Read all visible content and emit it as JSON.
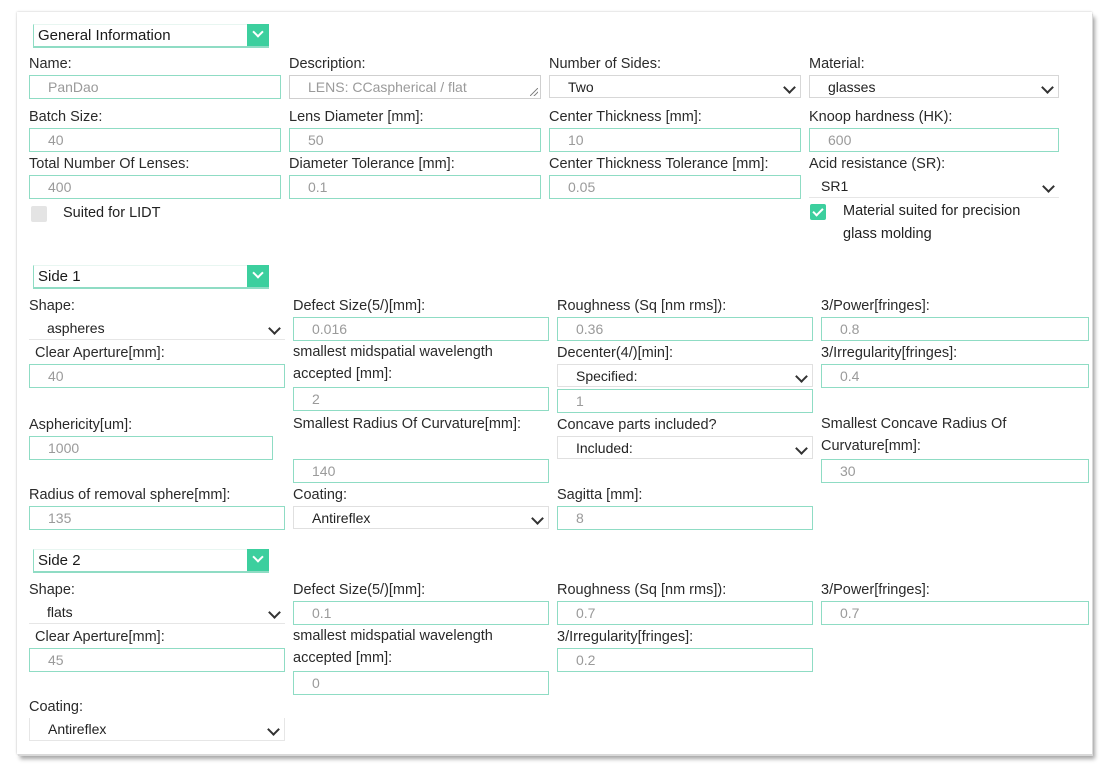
{
  "general": {
    "title": "General Information",
    "name_label": "Name:",
    "name_value": "PanDao",
    "description_label": "Description:",
    "description_value": "LENS:  CCaspherical / flat",
    "sides_label": "Number of Sides:",
    "sides_value": "Two",
    "material_label": "Material:",
    "material_value": "glasses",
    "batch_label": "Batch Size:",
    "batch_value": "40",
    "lens_diameter_label": "Lens Diameter [mm]:",
    "lens_diameter_value": "50",
    "center_thickness_label": "Center Thickness [mm]:",
    "center_thickness_value": "10",
    "knoop_label": "Knoop hardness (HK):",
    "knoop_value": "600",
    "total_label": "Total Number Of Lenses:",
    "total_value": "400",
    "diameter_tol_label": "Diameter Tolerance [mm]:",
    "diameter_tol_value": "0.1",
    "center_tol_label": "Center Thickness Tolerance [mm]:",
    "center_tol_value": "0.05",
    "acid_label": "Acid resistance (SR):",
    "acid_value": "SR1",
    "lidt_label": "Suited for LIDT",
    "lidt_checked": false,
    "molding_label": "Material suited for precision glass molding",
    "molding_checked": true
  },
  "side1": {
    "title": "Side 1",
    "shape_label": "Shape:",
    "shape_value": "aspheres",
    "defect_label": "Defect Size(5/)[mm]:",
    "defect_value": "0.016",
    "roughness_label": "Roughness (Sq [nm rms]):",
    "roughness_value": "0.36",
    "power_label": "3/Power[fringes]:",
    "power_value": "0.8",
    "clear_aperture_label": "Clear Aperture[mm]:",
    "clear_aperture_value": "40",
    "midspatial_label": "smallest midspatial wavelength accepted [mm]:",
    "midspatial_value": "2",
    "decenter_label": "Decenter(4/)[min]:",
    "decenter_select": "Specified:",
    "decenter_value": "1",
    "irregularity_label": "3/Irregularity[fringes]:",
    "irregularity_value": "0.4",
    "asphericity_label": "Asphericity[um]:",
    "asphericity_value": "1000",
    "radius_label": "Smallest Radius Of Curvature[mm]:",
    "radius_value": "140",
    "concave_label": "Concave parts included?",
    "concave_value": "Included:",
    "concave_radius_label": "Smallest Concave Radius Of Curvature[mm]:",
    "concave_radius_value": "30",
    "removal_label": "Radius of removal sphere[mm]:",
    "removal_value": "135",
    "coating_label": "Coating:",
    "coating_value": "Antireflex",
    "sagitta_label": "Sagitta [mm]:",
    "sagitta_value": "8"
  },
  "side2": {
    "title": "Side 2",
    "shape_label": "Shape:",
    "shape_value": "flats",
    "defect_label": "Defect Size(5/)[mm]:",
    "defect_value": "0.1",
    "roughness_label": "Roughness (Sq [nm rms]):",
    "roughness_value": "0.7",
    "power_label": "3/Power[fringes]:",
    "power_value": "0.7",
    "clear_aperture_label": "Clear Aperture[mm]:",
    "clear_aperture_value": "45",
    "midspatial_label": "smallest midspatial wavelength accepted [mm]:",
    "midspatial_value": "0",
    "irregularity_label": "3/Irregularity[fringes]:",
    "irregularity_value": "0.2",
    "coating_label": "Coating:",
    "coating_value": "Antireflex"
  },
  "colors": {
    "accent": "#3ccf9e",
    "field_border": "#8fdcc4",
    "placeholder_text": "#9a9a9a"
  }
}
